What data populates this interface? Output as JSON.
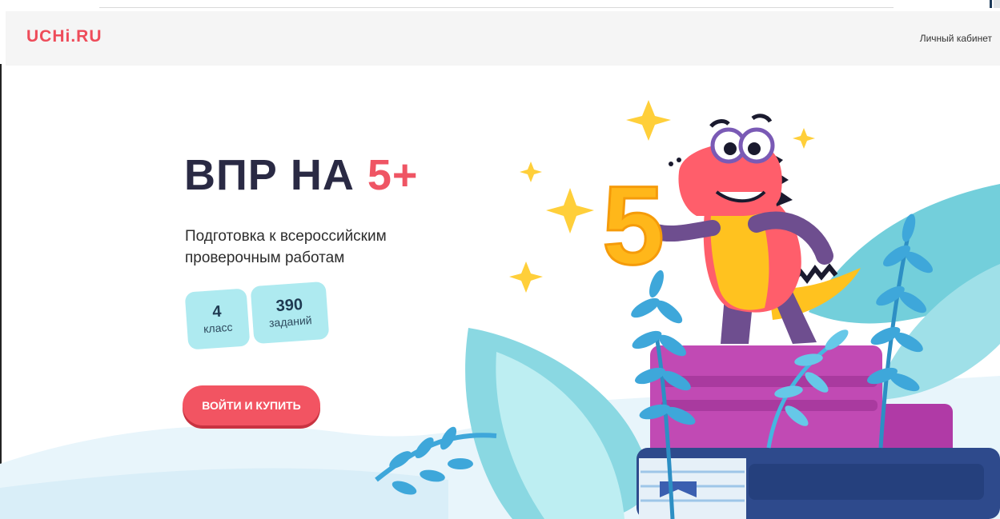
{
  "header": {
    "logo": "UCHi.RU",
    "account_link": "Личный кабинет"
  },
  "hero": {
    "title_main": "ВПР НА",
    "title_accent": "5+",
    "subtitle": "Подготовка к всероссийским проверочным работам",
    "stats": {
      "grade": {
        "value": "4",
        "label": "класс"
      },
      "tasks": {
        "value": "390",
        "label": "заданий"
      }
    },
    "cta_label": "ВОЙТИ И КУПИТЬ"
  },
  "illustration": {
    "number_on_card": "5"
  },
  "colors": {
    "brand": "#ee4c5a",
    "title": "#2a2a44",
    "stat_bg": "#aeeaf0",
    "cta": "#f25462"
  }
}
